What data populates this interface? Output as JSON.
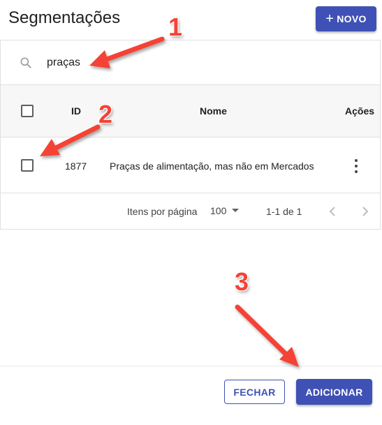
{
  "dialog": {
    "title": "Segmentações",
    "new_button_label": "NOVO"
  },
  "search": {
    "value": "praças",
    "icon": "search-icon"
  },
  "table": {
    "columns": [
      "ID",
      "Nome",
      "Ações"
    ],
    "rows": [
      {
        "id": "1877",
        "nome": "Praças de alimentação, mas não em Mercados"
      }
    ]
  },
  "paginator": {
    "items_per_page_label": "Itens por página",
    "page_size": "100",
    "range_label": "1-1 de 1"
  },
  "footer": {
    "close_label": "FECHAR",
    "add_label": "ADICIONAR"
  },
  "annotations": {
    "step1": "1",
    "step2": "2",
    "step3": "3"
  },
  "colors": {
    "primary": "#3f51b5",
    "annotation": "#f44336"
  }
}
